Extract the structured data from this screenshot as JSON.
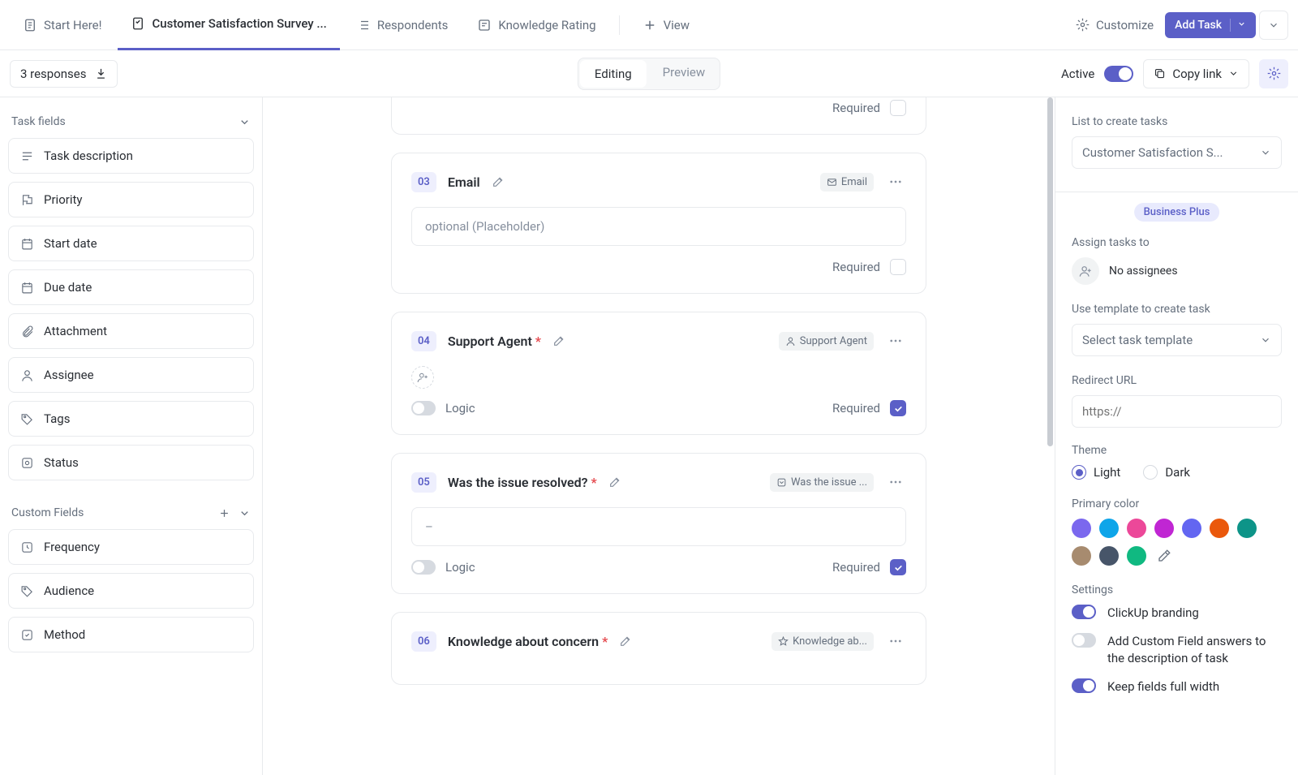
{
  "topbar": {
    "tabs": [
      {
        "label": "Start Here!"
      },
      {
        "label": "Customer Satisfaction Survey ..."
      },
      {
        "label": "Respondents"
      },
      {
        "label": "Knowledge Rating"
      },
      {
        "label": "View"
      }
    ],
    "customize": "Customize",
    "add_task": "Add Task"
  },
  "subbar": {
    "responses": "3 responses",
    "editing": "Editing",
    "preview": "Preview",
    "active": "Active",
    "copy_link": "Copy link"
  },
  "left": {
    "task_fields_header": "Task fields",
    "task_fields": [
      "Task description",
      "Priority",
      "Start date",
      "Due date",
      "Attachment",
      "Assignee",
      "Tags",
      "Status"
    ],
    "custom_fields_header": "Custom Fields",
    "custom_fields": [
      "Frequency",
      "Audience",
      "Method"
    ]
  },
  "cards": [
    {
      "num": "03",
      "title": "Email",
      "required_star": false,
      "badge": "Email",
      "badge_icon": "mail",
      "placeholder": "optional (Placeholder)",
      "show_logic": false,
      "required_checked": false,
      "show_top_only": false,
      "show_avatar": false
    },
    {
      "num": "04",
      "title": "Support Agent",
      "required_star": true,
      "badge": "Support Agent",
      "badge_icon": "person",
      "placeholder": null,
      "show_logic": true,
      "required_checked": true,
      "show_top_only": false,
      "show_avatar": true
    },
    {
      "num": "05",
      "title": "Was the issue resolved?",
      "required_star": true,
      "badge": "Was the issue ...",
      "badge_icon": "select",
      "placeholder": "–",
      "show_logic": true,
      "required_checked": true,
      "show_top_only": false,
      "show_avatar": false
    },
    {
      "num": "06",
      "title": "Knowledge about concern",
      "required_star": true,
      "badge": "Knowledge ab...",
      "badge_icon": "star",
      "placeholder": null,
      "show_logic": false,
      "required_checked": false,
      "show_top_only": true,
      "show_avatar": false
    }
  ],
  "required_label": "Required",
  "logic_label": "Logic",
  "right": {
    "list_label": "List to create tasks",
    "list_value": "Customer Satisfaction S...",
    "biz_badge": "Business Plus",
    "assign_label": "Assign tasks to",
    "no_assignees": "No assignees",
    "template_label": "Use template to create task",
    "template_value": "Select task template",
    "redirect_label": "Redirect URL",
    "redirect_placeholder": "https://",
    "theme_label": "Theme",
    "theme_light": "Light",
    "theme_dark": "Dark",
    "color_label": "Primary color",
    "colors": [
      "#7b68ee",
      "#0ea5e9",
      "#ec4899",
      "#c026d3",
      "#6366f1",
      "#ea580c",
      "#0d9488",
      "#a78b6f",
      "#475569",
      "#10b981"
    ],
    "settings_label": "Settings",
    "settings": [
      {
        "label": "ClickUp branding",
        "on": true
      },
      {
        "label": "Add Custom Field answers to the description of task",
        "on": false
      },
      {
        "label": "Keep fields full width",
        "on": true
      }
    ]
  }
}
